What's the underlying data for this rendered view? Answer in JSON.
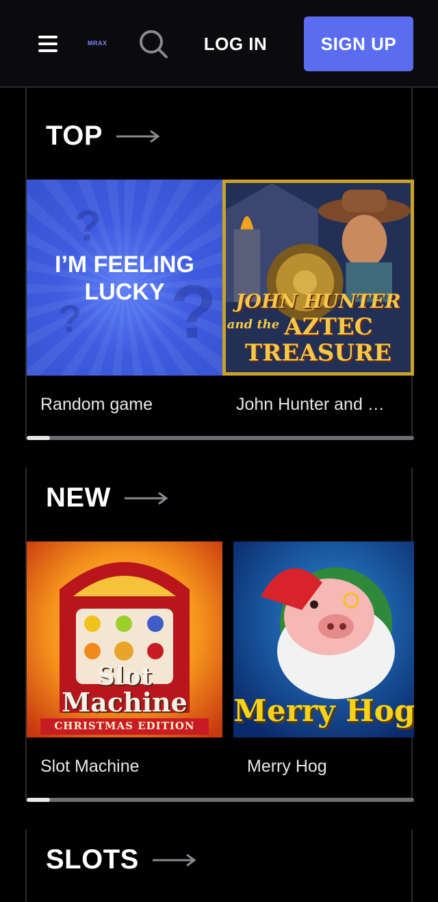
{
  "header": {
    "logo_text": "MRAX",
    "login_label": "LOG IN",
    "signup_label": "SIGN UP"
  },
  "sections": [
    {
      "title": "TOP",
      "tiles": [
        {
          "art_text": "I’M FEELING LUCKY",
          "label": "Random game"
        },
        {
          "art_lines": [
            "JOHN HUNTER",
            "and the",
            "AZTEC",
            "TREASURE"
          ],
          "label": "John Hunter and …"
        }
      ]
    },
    {
      "title": "NEW",
      "tiles": [
        {
          "art_lines": [
            "Slot",
            "Machine",
            "CHRISTMAS EDITION"
          ],
          "label": "Slot Machine"
        },
        {
          "art_lines": [
            "Merry Hog"
          ],
          "label": "Merry Hog"
        }
      ]
    },
    {
      "title": "SLOTS"
    }
  ],
  "colors": {
    "accent": "#5a6cf0",
    "header_bg": "#0b0b0d",
    "page_bg": "#000000"
  }
}
